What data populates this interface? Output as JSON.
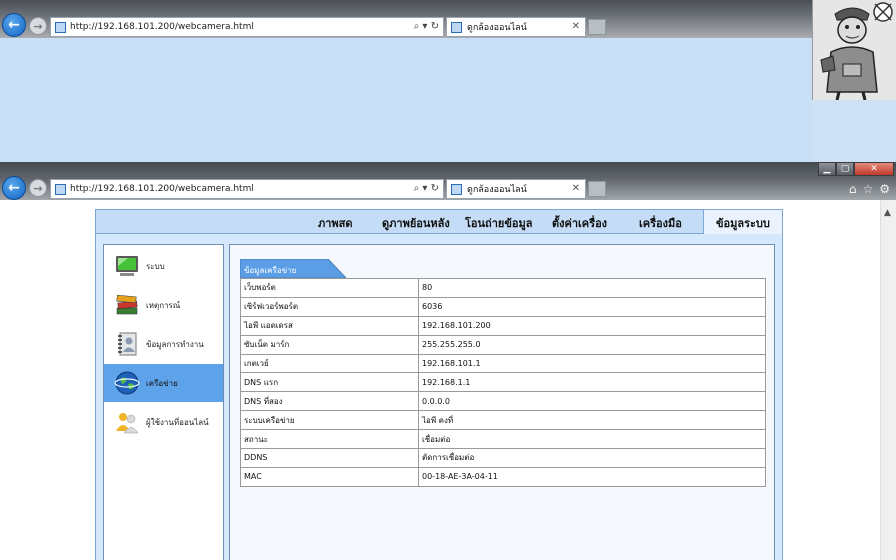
{
  "top_browser": {
    "url": "http://192.168.101.200/webcamera.html",
    "tab_title": "ดูกล้องออนไลน์",
    "tab_close": "✕",
    "address_tools": "⌕ ▾ ↻"
  },
  "main_browser": {
    "url": "http://192.168.101.200/webcamera.html",
    "tab_title": "ดูกล้องออนไลน์",
    "tab_close": "✕",
    "address_tools": "⌕ ▾ ↻",
    "window_controls": {
      "minimize": "▁",
      "maximize": "▢",
      "close": "✕"
    },
    "toolbar_icons": [
      "home-icon",
      "star-icon",
      "gear-icon"
    ]
  },
  "menu": {
    "items": [
      {
        "label": "ภาพสด"
      },
      {
        "label": "ดูภาพย้อนหลัง"
      },
      {
        "label": "โอนถ่ายข้อมูล"
      },
      {
        "label": "ตั้งค่าเครื่อง"
      },
      {
        "label": "เครื่องมือ"
      },
      {
        "label": "ข้อมูลระบบ",
        "active": true
      }
    ]
  },
  "sidebar": {
    "items": [
      {
        "label": "ระบบ",
        "icon": "monitor-icon"
      },
      {
        "label": "เหตุการณ์",
        "icon": "books-icon"
      },
      {
        "label": "ข้อมูลการทำงาน",
        "icon": "notebook-user-icon"
      },
      {
        "label": "เครือข่าย",
        "icon": "globe-network-icon",
        "active": true
      },
      {
        "label": "ผู้ใช้งานที่ออนไลน์",
        "icon": "users-icon"
      }
    ]
  },
  "panel": {
    "title": "ข้อมูลเครือข่าย",
    "rows": [
      {
        "key": "เว็บพอร์ต",
        "value": "80"
      },
      {
        "key": "เซิร์ฟเวอร์พอร์ต",
        "value": "6036"
      },
      {
        "key": "ไอพี แอดเดรส",
        "value": "192.168.101.200"
      },
      {
        "key": "ซับเน็ต มาร์ก",
        "value": "255.255.255.0"
      },
      {
        "key": "เกตเวย์",
        "value": "192.168.101.1"
      },
      {
        "key": "DNS แรก",
        "value": "192.168.1.1"
      },
      {
        "key": "DNS ที่สอง",
        "value": "0.0.0.0"
      },
      {
        "key": "ระบบเครือข่าย",
        "value": "ไอพี คงที่"
      },
      {
        "key": "สถานะ",
        "value": "เชื่อมต่อ"
      },
      {
        "key": "DDNS",
        "value": "ตัดการเชื่อมต่อ"
      },
      {
        "key": "MAC",
        "value": "00-18-AE-3A-04-11"
      }
    ]
  },
  "colors": {
    "accent": "#5ea3ea",
    "panel_tab": "#5b9ee6",
    "app_bg": "#d6e8fb"
  }
}
